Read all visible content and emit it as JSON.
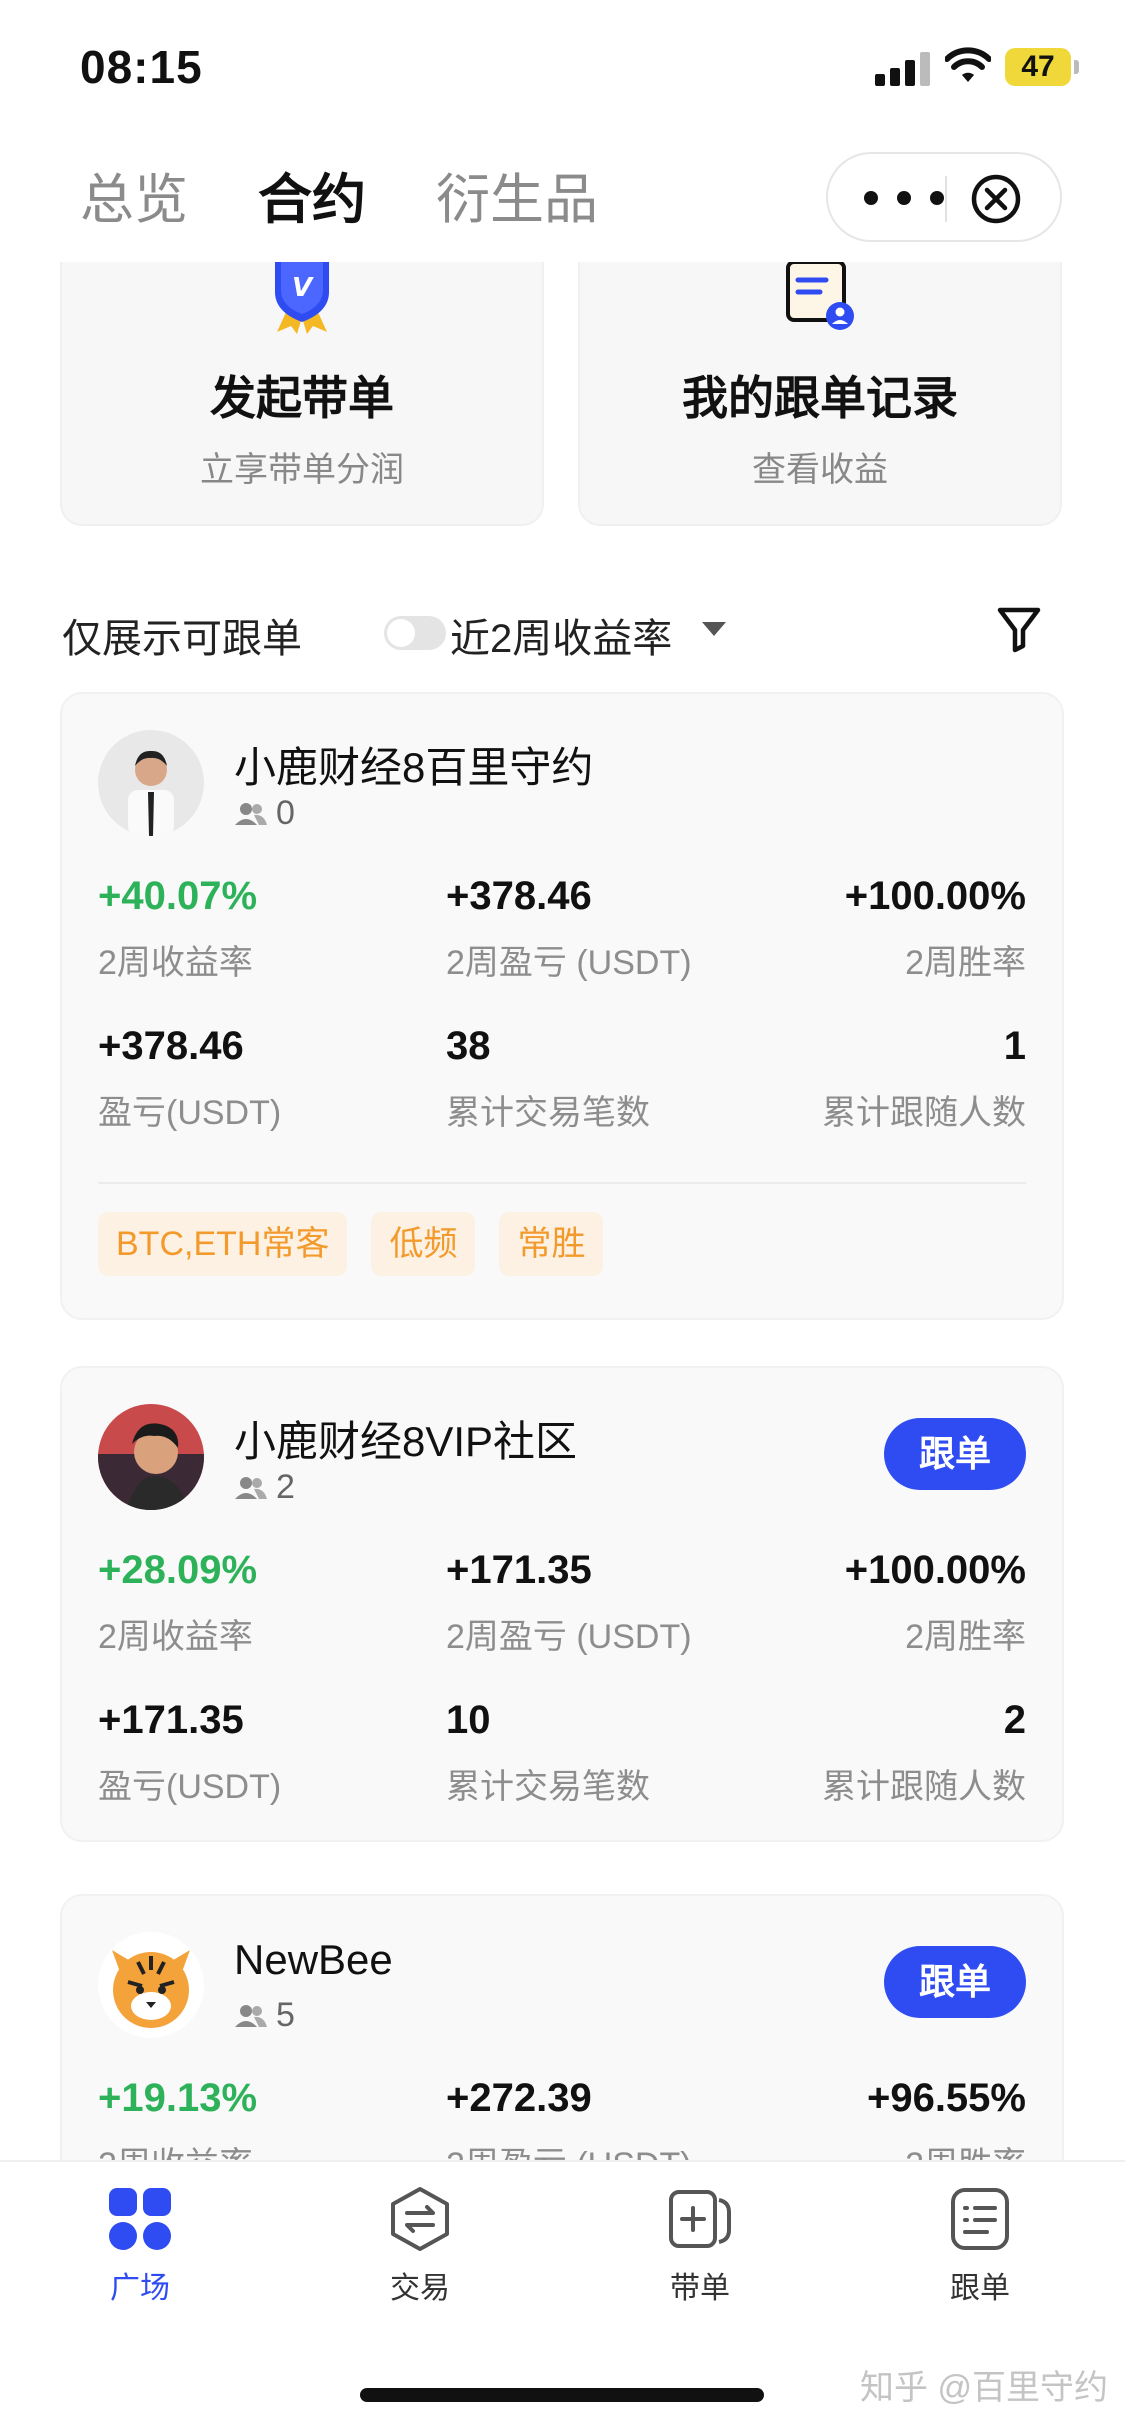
{
  "status_bar": {
    "time": "08:15",
    "battery": "47"
  },
  "tabs": [
    {
      "label": "总览",
      "active": false
    },
    {
      "label": "合约",
      "active": true
    },
    {
      "label": "衍生品",
      "active": false
    }
  ],
  "top_cards": {
    "start": {
      "title": "发起带单",
      "subtitle": "立享带单分润"
    },
    "records": {
      "title": "我的跟单记录",
      "subtitle": "查看收益"
    }
  },
  "filter": {
    "only_label": "仅展示可跟单",
    "only_toggle_on": false,
    "sort_label": "近2周收益率"
  },
  "traders": [
    {
      "name": "小鹿财经8百里守约",
      "followers": "0",
      "follow_button": "",
      "row1": [
        {
          "value": "+40.07%",
          "label": "2周收益率",
          "color": "green"
        },
        {
          "value": "+378.46",
          "label": "2周盈亏 (USDT)",
          "color": "black"
        },
        {
          "value": "+100.00%",
          "label": "2周胜率",
          "color": "black"
        }
      ],
      "row2": [
        {
          "value": "+378.46",
          "label": "盈亏(USDT)"
        },
        {
          "value": "38",
          "label": "累计交易笔数"
        },
        {
          "value": "1",
          "label": "累计跟随人数"
        }
      ],
      "tags": [
        "BTC,ETH常客",
        "低频",
        "常胜"
      ]
    },
    {
      "name": "小鹿财经8VIP社区",
      "followers": "2",
      "follow_button": "跟单",
      "row1": [
        {
          "value": "+28.09%",
          "label": "2周收益率",
          "color": "green"
        },
        {
          "value": "+171.35",
          "label": "2周盈亏 (USDT)",
          "color": "black"
        },
        {
          "value": "+100.00%",
          "label": "2周胜率",
          "color": "black"
        }
      ],
      "row2": [
        {
          "value": "+171.35",
          "label": "盈亏(USDT)"
        },
        {
          "value": "10",
          "label": "累计交易笔数"
        },
        {
          "value": "2",
          "label": "累计跟随人数"
        }
      ],
      "tags": []
    },
    {
      "name": "NewBee",
      "followers": "5",
      "follow_button": "跟单",
      "row1": [
        {
          "value": "+19.13%",
          "label": "2周收益率",
          "color": "green"
        },
        {
          "value": "+272.39",
          "label": "2周盈亏 (USDT)",
          "color": "black"
        },
        {
          "value": "+96.55%",
          "label": "2周胜率",
          "color": "black"
        }
      ],
      "row2": [],
      "tags": []
    }
  ],
  "bottom_nav": [
    {
      "label": "广场",
      "icon": "grid-icon",
      "active": true
    },
    {
      "label": "交易",
      "icon": "swap-icon",
      "active": false
    },
    {
      "label": "带单",
      "icon": "lead-icon",
      "active": false
    },
    {
      "label": "跟单",
      "icon": "copy-list-icon",
      "active": false
    }
  ],
  "watermark": "知乎 @百里守约",
  "colors": {
    "accent": "#2f4cf2",
    "positive": "#2db25a",
    "tag_bg": "#fdf1e3",
    "tag_text": "#f39a2c"
  }
}
